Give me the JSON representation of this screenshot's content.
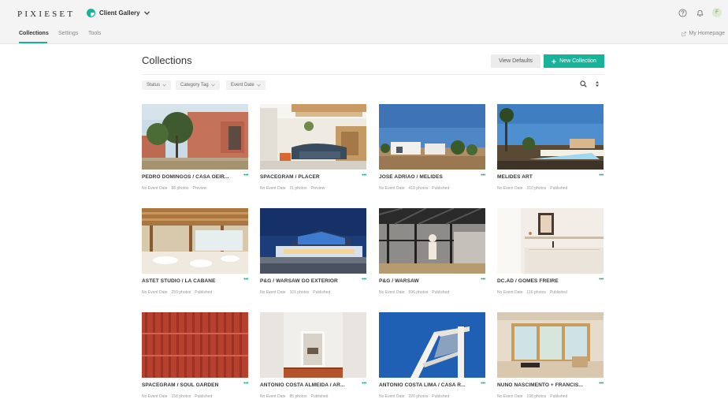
{
  "app": {
    "logo": "PIXIESET",
    "product_name": "Client Gallery",
    "avatar_initial": "F"
  },
  "nav": {
    "tabs": [
      "Collections",
      "Settings",
      "Tools"
    ],
    "active_tab": "Collections",
    "homepage_link": "My Homepage"
  },
  "page": {
    "title": "Collections",
    "view_defaults_label": "View Defaults",
    "new_collection_label": "New Collection"
  },
  "filters": [
    "Status",
    "Category Tag",
    "Event Date"
  ],
  "collections": [
    {
      "title": "PEDRO DOMINGOS / CASA OEIR...",
      "date": "No Event Date",
      "photos": "88 photos",
      "status": "Preview"
    },
    {
      "title": "SPACEGRAM / PLACER",
      "date": "No Event Date",
      "photos": "21 photos",
      "status": "Preview"
    },
    {
      "title": "JOSÉ ADRIÃO / MELIDES",
      "date": "No Event Date",
      "photos": "418 photos",
      "status": "Published"
    },
    {
      "title": "MELIDES ART",
      "date": "No Event Date",
      "photos": "310 photos",
      "status": "Published"
    },
    {
      "title": "ASTET STUDIO / LA CABANE",
      "date": "No Event Date",
      "photos": "259 photos",
      "status": "Published"
    },
    {
      "title": "P&G / WARSAW GO EXTERIOR",
      "date": "No Event Date",
      "photos": "101 photos",
      "status": "Published"
    },
    {
      "title": "P&G / WARSAW",
      "date": "No Event Date",
      "photos": "596 photos",
      "status": "Published"
    },
    {
      "title": "DC.AD / GOMES FREIRE",
      "date": "No Event Date",
      "photos": "116 photos",
      "status": "Published"
    },
    {
      "title": "SPACEGRAM / SOUL GARDEN",
      "date": "No Event Date",
      "photos": "158 photos",
      "status": "Published"
    },
    {
      "title": "ANTÓNIO COSTA ALMEIDA / AR...",
      "date": "No Event Date",
      "photos": "85 photos",
      "status": "Published"
    },
    {
      "title": "ANTÓNIO COSTA LIMA / CASA R...",
      "date": "No Event Date",
      "photos": "220 photos",
      "status": "Published"
    },
    {
      "title": "NUNO NASCIMENTO + FRANCIS...",
      "date": "No Event Date",
      "photos": "198 photos",
      "status": "Published"
    }
  ],
  "colors": {
    "accent": "#19b39b",
    "topbar_bg": "#f4f4f4",
    "text": "#333333"
  },
  "icons": [
    "help-icon",
    "bell-icon",
    "external-link-icon",
    "plus-icon",
    "search-icon",
    "sort-icon",
    "more-icon",
    "chevron-down-icon"
  ]
}
